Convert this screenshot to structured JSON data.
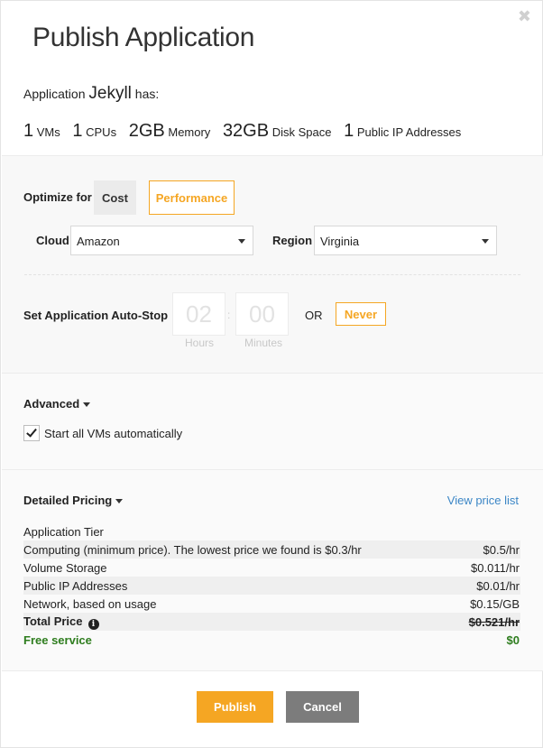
{
  "dialog": {
    "title": "Publish Application",
    "close_icon": "close-icon"
  },
  "application": {
    "prefix": "Application",
    "name": "Jekyll",
    "suffix": "has:"
  },
  "resources": [
    {
      "value": "1",
      "label": "VMs"
    },
    {
      "value": "1",
      "label": "CPUs"
    },
    {
      "value": "2GB",
      "label": "Memory"
    },
    {
      "value": "32GB",
      "label": "Disk Space"
    },
    {
      "value": "1",
      "label": "Public IP Addresses"
    }
  ],
  "optimize": {
    "label": "Optimize for",
    "options": [
      "Cost",
      "Performance"
    ],
    "selected": "Performance"
  },
  "cloud": {
    "label": "Cloud",
    "value": "Amazon"
  },
  "region": {
    "label": "Region",
    "value": "Virginia"
  },
  "autostop": {
    "label": "Set Application Auto-Stop",
    "hours": "02",
    "minutes": "00",
    "hours_label": "Hours",
    "minutes_label": "Minutes",
    "separator": ":",
    "or_text": "OR",
    "never_label": "Never"
  },
  "advanced": {
    "label": "Advanced",
    "start_vms_label": "Start all VMs automatically",
    "start_vms_checked": true
  },
  "pricing": {
    "label": "Detailed Pricing",
    "view_link": "View price list",
    "rows": [
      {
        "label": "Application Tier",
        "value": ""
      },
      {
        "label": "Computing (minimum price). The lowest price we found is $0.3/hr",
        "value": "$0.5/hr"
      },
      {
        "label": "Volume Storage",
        "value": "$0.011/hr"
      },
      {
        "label": "Public IP Addresses",
        "value": "$0.01/hr"
      },
      {
        "label": "Network, based on usage",
        "value": "$0.15/GB"
      }
    ],
    "total_label": "Total Price",
    "total_value": "$0.521/hr",
    "free_label": "Free service",
    "free_value": "$0"
  },
  "buttons": {
    "publish": "Publish",
    "cancel": "Cancel"
  },
  "colors": {
    "accent": "#f5a623",
    "link": "#3b86c6",
    "free": "#2e7d1e",
    "cancel": "#7c7c7c"
  }
}
